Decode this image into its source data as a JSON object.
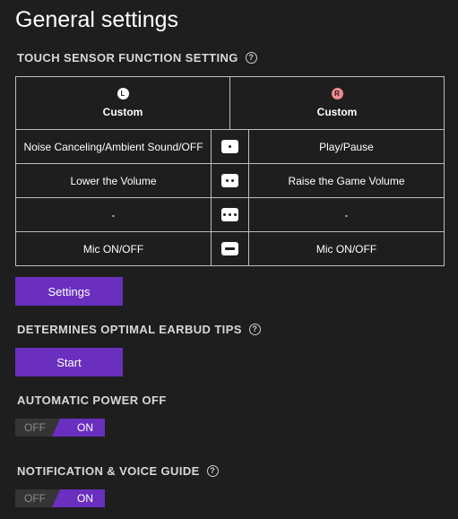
{
  "page_title": "General settings",
  "touch_sensor": {
    "heading": "TOUCH SENSOR FUNCTION SETTING",
    "left": {
      "badge": "L",
      "label": "Custom"
    },
    "right": {
      "badge": "R",
      "label": "Custom"
    },
    "rows": [
      {
        "left": "Noise Canceling/Ambient Sound/OFF",
        "gesture_icon": "single-tap-icon",
        "right": "Play/Pause"
      },
      {
        "left": "Lower the Volume",
        "gesture_icon": "double-tap-icon",
        "right": "Raise the Game Volume"
      },
      {
        "left": "-",
        "gesture_icon": "triple-tap-icon",
        "right": "-"
      },
      {
        "left": "Mic ON/OFF",
        "gesture_icon": "hold-icon",
        "right": "Mic ON/OFF"
      }
    ],
    "settings_button": "Settings"
  },
  "earbud_tips": {
    "heading": "DETERMINES OPTIMAL EARBUD TIPS",
    "start_button": "Start"
  },
  "auto_power_off": {
    "heading": "AUTOMATIC POWER OFF",
    "off_label": "OFF",
    "on_label": "ON",
    "state": "ON"
  },
  "notification": {
    "heading": "NOTIFICATION & VOICE GUIDE",
    "off_label": "OFF",
    "on_label": "ON",
    "state": "ON"
  },
  "help_glyph": "?",
  "colors": {
    "background": "#1f1e1f",
    "accent": "#6a2fbe",
    "right_badge": "#f08a8f",
    "border": "#bdbdbd"
  }
}
